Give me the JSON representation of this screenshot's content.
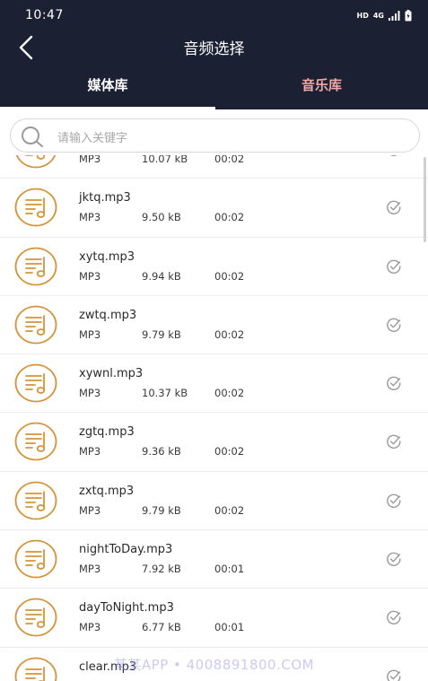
{
  "status_bar": {
    "time": "10:47",
    "network_type": "HD",
    "signal_label": "4G"
  },
  "header": {
    "title": "音频选择",
    "back_icon": "chevron-left-icon"
  },
  "tabs": [
    {
      "label": "媒体库",
      "active": true
    },
    {
      "label": "音乐库",
      "active": false
    }
  ],
  "search": {
    "placeholder": "请输入关键字",
    "icon": "search-icon"
  },
  "files": [
    {
      "name": "",
      "type": "MP3",
      "size": "10.07 kB",
      "duration": "00:02"
    },
    {
      "name": "jktq.mp3",
      "type": "MP3",
      "size": "9.50 kB",
      "duration": "00:02"
    },
    {
      "name": "xytq.mp3",
      "type": "MP3",
      "size": "9.94 kB",
      "duration": "00:02"
    },
    {
      "name": "zwtq.mp3",
      "type": "MP3",
      "size": "9.79 kB",
      "duration": "00:02"
    },
    {
      "name": "xywnl.mp3",
      "type": "MP3",
      "size": "10.37 kB",
      "duration": "00:02"
    },
    {
      "name": "zgtq.mp3",
      "type": "MP3",
      "size": "9.36 kB",
      "duration": "00:02"
    },
    {
      "name": "zxtq.mp3",
      "type": "MP3",
      "size": "9.79 kB",
      "duration": "00:02"
    },
    {
      "name": "nightToDay.mp3",
      "type": "MP3",
      "size": "7.92 kB",
      "duration": "00:01"
    },
    {
      "name": "dayToNight.mp3",
      "type": "MP3",
      "size": "6.77 kB",
      "duration": "00:01"
    },
    {
      "name": "clear.mp3",
      "type": "",
      "size": "",
      "duration": ""
    }
  ],
  "watermark": "某某APP • 4008891800.COM",
  "colors": {
    "header_bg": "#1b2133",
    "accent_gold": "#d4953a",
    "tab_inactive": "#f3a7a7"
  }
}
